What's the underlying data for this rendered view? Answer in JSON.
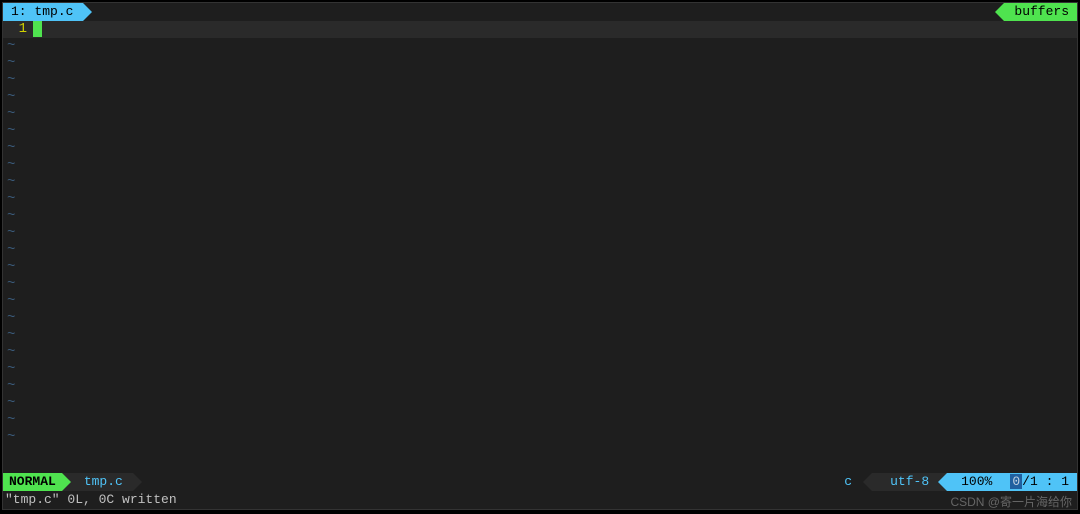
{
  "tabbar": {
    "tab_index": "1:",
    "tab_name": "tmp.c",
    "buffers_label": "buffers"
  },
  "editor": {
    "line_number": "1",
    "line_content": "",
    "tilde": "~",
    "empty_lines": 24
  },
  "status": {
    "mode": "NORMAL",
    "filename": "tmp.c",
    "filetype": "c",
    "encoding": "utf-8",
    "percent": "100%",
    "cur_line": "0",
    "total_lines": "1",
    "col": "1"
  },
  "cmdline": {
    "message": "\"tmp.c\" 0L, 0C written"
  },
  "watermark": "CSDN @寄一片海给你"
}
